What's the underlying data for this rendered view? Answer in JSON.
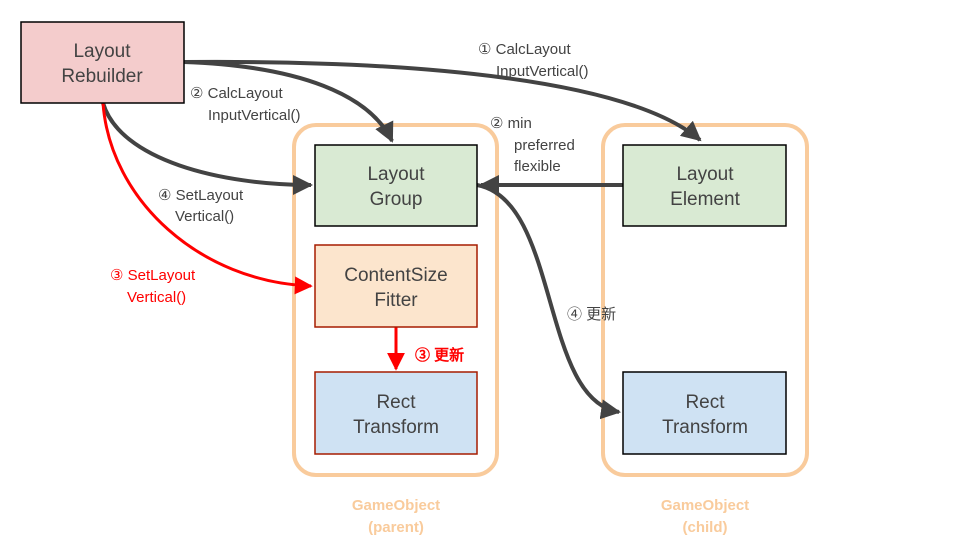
{
  "colors": {
    "arrow": "#434343",
    "highlight_arrow": "#ff0000",
    "rebuilder_fill": "#f4cccc",
    "layout_fill": "#d9ead3",
    "fitter_fill": "#fce5cd",
    "rect_fill": "#cfe2f3",
    "gameobject_border": "#f9cb9c"
  },
  "nodes": {
    "rebuilder": [
      "Layout",
      "Rebuilder"
    ],
    "layout_group": [
      "Layout",
      "Group"
    ],
    "content_size_fitter": [
      "ContentSize",
      "Fitter"
    ],
    "parent_rect_transform": [
      "Rect",
      "Transform"
    ],
    "layout_element": [
      "Layout",
      "Element"
    ],
    "child_rect_transform": [
      "Rect",
      "Transform"
    ]
  },
  "containers": {
    "parent": [
      "GameObject",
      "(parent)"
    ],
    "child": [
      "GameObject",
      "(child)"
    ]
  },
  "edges": {
    "calc_child": [
      "① CalcLayout",
      "InputVertical()"
    ],
    "calc_parent": [
      "② CalcLayout",
      "InputVertical()"
    ],
    "min_pref_flex": [
      "② min",
      "preferred",
      "flexible"
    ],
    "set_group": [
      "④ SetLayout",
      "Vertical()"
    ],
    "set_fitter": [
      "③ SetLayout",
      "Vertical()"
    ],
    "fitter_update": "③ 更新",
    "group_update": "④ 更新"
  }
}
